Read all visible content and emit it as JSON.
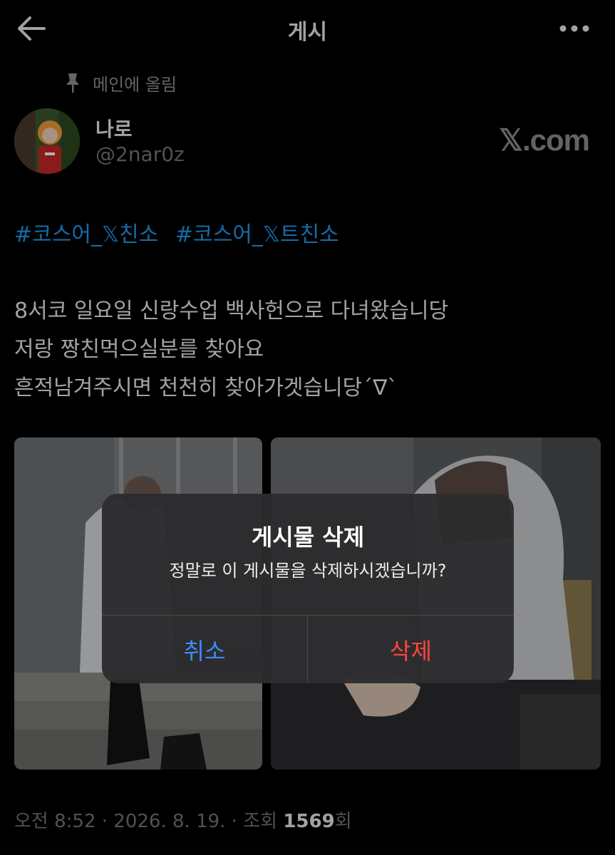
{
  "header": {
    "title": "게시",
    "back_icon": "arrow-left-icon",
    "more_icon": "more-horizontal-icon"
  },
  "post": {
    "pinned_label": "메인에 올림",
    "author": {
      "name": "나로",
      "handle": "@2nar0z"
    },
    "watermark": "𝕏.com",
    "hashtags": [
      "#코스어_𝕏친소",
      "#코스어_𝕏트친소"
    ],
    "lines": [
      "8서코 일요일 신랑수업 백사헌으로 다녀왔습니당",
      "저랑 짱친먹으실분를 찾아요",
      "흔적남겨주시면 천천히 찾아가겟습니당´∇`"
    ],
    "meta": {
      "time": "오전 8:52",
      "date": "2026. 8. 19.",
      "views_label": "조회",
      "views_count": "1569",
      "views_suffix": "회"
    }
  },
  "dialog": {
    "title": "게시물 삭제",
    "message": "정말로 이 게시물을 삭제하시겠습니까?",
    "cancel_label": "취소",
    "delete_label": "삭제",
    "colors": {
      "cancel": "#3d8cff",
      "delete": "#ff453a"
    }
  },
  "colors": {
    "background": "#000000",
    "hashtag": "#1d9bf0",
    "secondary_text": "#71767b"
  }
}
